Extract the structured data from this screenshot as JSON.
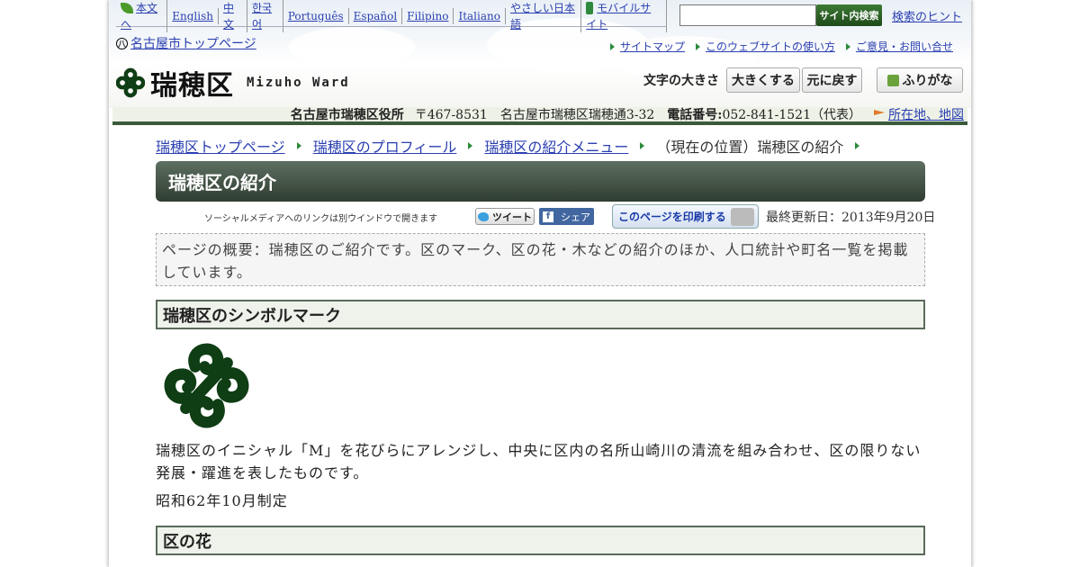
{
  "lang_links": [
    "本文へ",
    "English",
    "中文",
    "한국어",
    "Português",
    "Español",
    "Filipino",
    "Italiano",
    "やさしい日本語",
    "モバイルサイト"
  ],
  "search": {
    "value": "",
    "button_label": "サイト内検索",
    "hint_label": "検索のヒント"
  },
  "city_top_label": "名古屋市トップページ",
  "utility_links": [
    "サイトマップ",
    "このウェブサイトの使い方",
    "ご意見・お問い合せ"
  ],
  "logo": {
    "name": "瑞穂区",
    "english": "Mizuho Ward"
  },
  "text_size": {
    "label": "文字の大きさ",
    "bigger": "大きくする",
    "reset": "元に戻す"
  },
  "furigana_label": "ふりがな",
  "office": {
    "name": "名古屋市瑞穂区役所",
    "postal": "〒467-8531　名古屋市瑞穂区瑞穂通3-32",
    "phone_label": "電話番号:",
    "phone": "052-841-1521（代表）",
    "map_link": "所在地、地図"
  },
  "breadcrumb": [
    "瑞穂区トップページ",
    "瑞穂区のプロフィール",
    "瑞穂区の紹介メニュー"
  ],
  "breadcrumb_current": "（現在の位置）瑞穂区の紹介",
  "page_title": "瑞穂区の紹介",
  "social": {
    "note": "ソーシャルメディアへのリンクは別ウインドウで開きます",
    "tweet": "ツイート",
    "share": "シェア"
  },
  "print_label": "このページを印刷する",
  "last_updated": "最終更新日：2013年9月20日",
  "summary": "ページの概要：瑞穂区のご紹介です。区のマーク、区の花・木などの紹介のほか、人口統計や町名一覧を掲載しています。",
  "sections": {
    "symbol": {
      "heading": "瑞穂区のシンボルマーク",
      "description": "瑞穂区のイニシャル「M」を花びらにアレンジし、中央に区内の名所山崎川の清流を組み合わせ、区の限りない発展・躍進を表したものです。",
      "established": "昭和62年10月制定"
    },
    "flower": {
      "heading": "区の花"
    }
  },
  "colors": {
    "accent_green": "#2f3d31",
    "link_blue": "#2b3fb0"
  }
}
